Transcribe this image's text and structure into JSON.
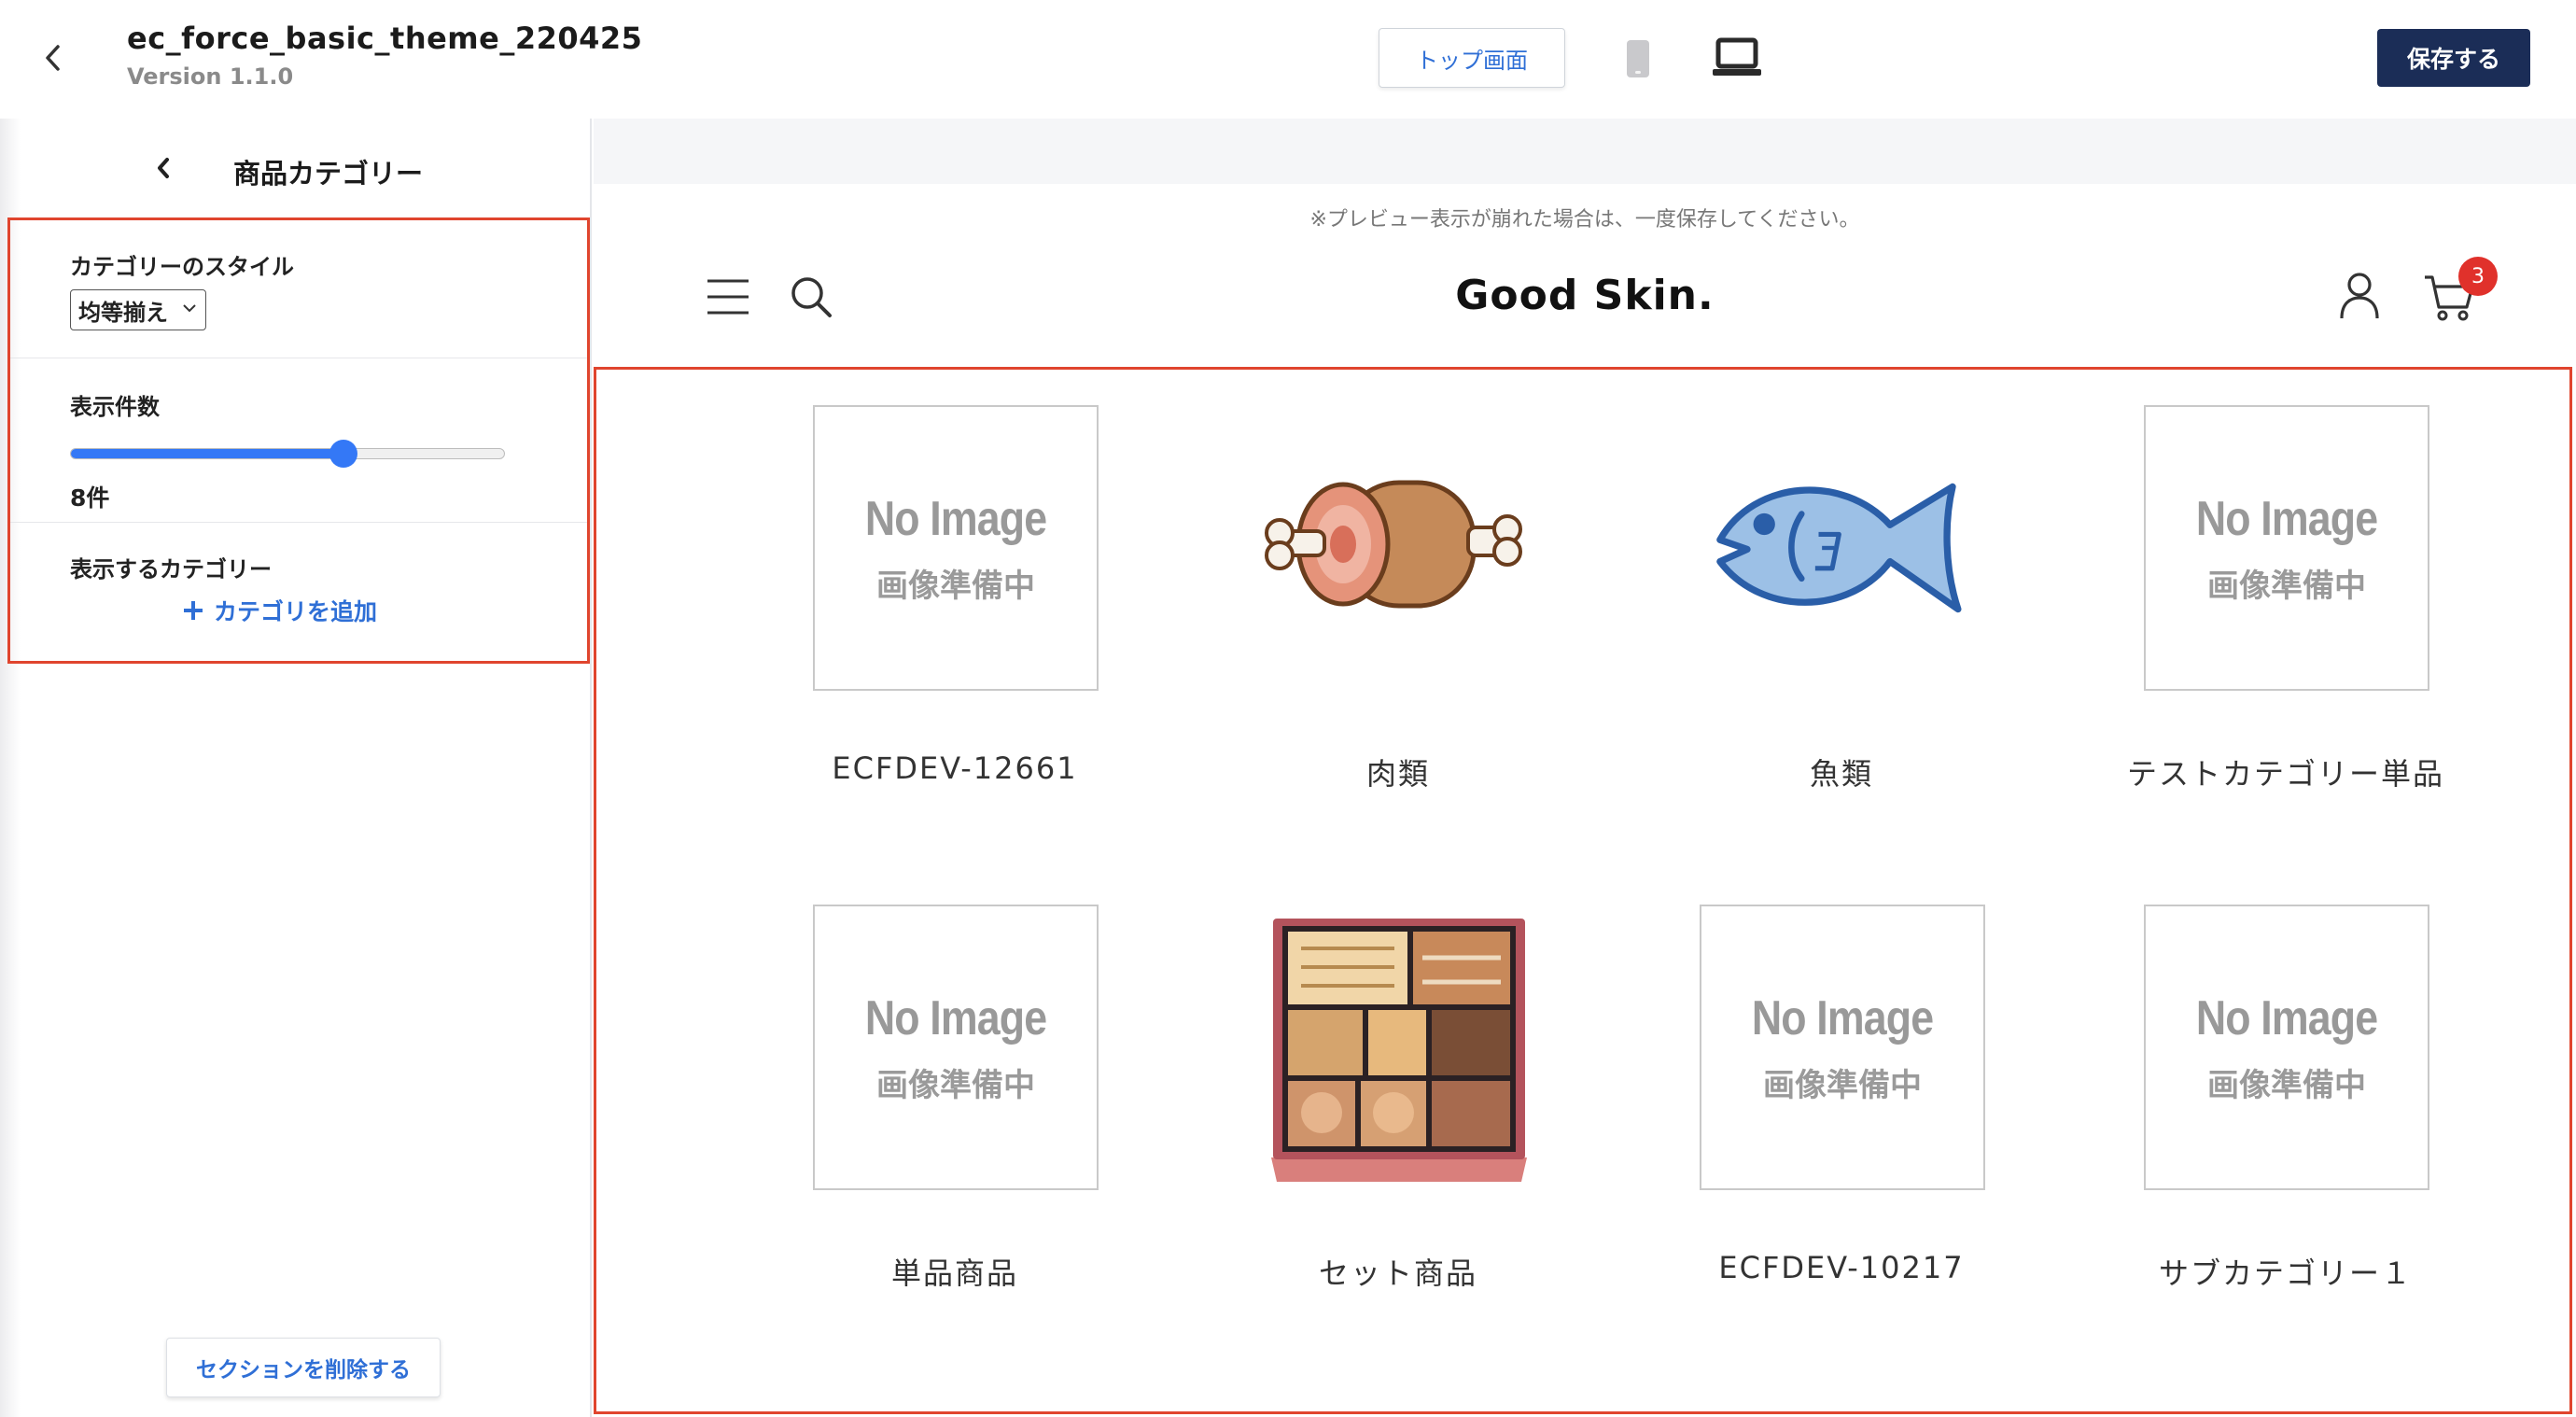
{
  "header": {
    "theme_name": "ec_force_basic_theme_220425",
    "version": "Version 1.1.0",
    "top_page_button": "トップ画面",
    "save_button": "保存する"
  },
  "sidebar": {
    "title": "商品カテゴリー",
    "style_label": "カテゴリーのスタイル",
    "style_value": "均等揃え",
    "count_label": "表示件数",
    "count_value": "8件",
    "count_slider_fraction": 0.63,
    "display_label": "表示するカテゴリー",
    "add_category": "カテゴリを追加",
    "delete_section": "セクションを削除する"
  },
  "preview": {
    "notice": "※プレビュー表示が崩れた場合は、一度保存してください。",
    "logo": "Good Skin.",
    "cart_count": "3",
    "no_image_en": "No Image",
    "no_image_jp": "画像準備中",
    "categories": [
      {
        "name": "ECFDEV-12661",
        "image": "no-image"
      },
      {
        "name": "肉類",
        "image": "meat-illustration"
      },
      {
        "name": "魚類",
        "image": "fish-illustration"
      },
      {
        "name": "テストカテゴリー単品",
        "image": "no-image"
      },
      {
        "name": "単品商品",
        "image": "no-image"
      },
      {
        "name": "セット商品",
        "image": "bento-box-illustration"
      },
      {
        "name": "ECFDEV-10217",
        "image": "no-image"
      },
      {
        "name": "サブカテゴリー１",
        "image": "no-image"
      }
    ]
  },
  "colors": {
    "accent_blue": "#2f6fd6",
    "save_navy": "#1b2d57",
    "highlight_red": "#e0452e",
    "badge_red": "#e0312b"
  }
}
